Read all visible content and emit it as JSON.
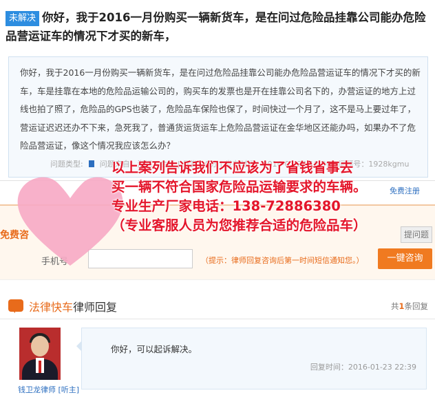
{
  "question": {
    "status_badge": "未解决",
    "title": "你好，我于2016一月份购买一辆新货车，是在问过危险品挂靠公司能办危险品营运证车的情况下才买的新车，",
    "body": "你好，我于2016一月份购买一辆新货车，是在问过危险品挂靠公司能办危险品营运证车的情况下才买的新车，车是挂靠在本地的危险品运输公司的，购买车的发票也是开在挂靠公司名下的，办营运证的地方上过线也拍了照了，危险品的GPS也装了，危险品车保险也保了，时间快过一个月了，这不是马上要过年了，营运证迟迟还办不下来，急死我了，普通货运货运车上危险品营运证在金华地区还能办吗，如果办不了危险品营运证，像这个情况我应该怎么办？",
    "meta_label": "问题类型:",
    "meta_rest": "问题来自：浙江 · 金华 | 悬赏：0分 | 发布时间：2016-01-23 19:36 | 问题号：1928kgmu"
  },
  "register_link": "免费注册",
  "free_consult": {
    "label": "免费咨",
    "ask_button": "提问题",
    "phone_label": "手机号",
    "phone_value": "",
    "tip": "（提示：律师回复咨询后第一时间短信通知您。）",
    "submit_button": "一键咨询"
  },
  "answers": {
    "title_highlight": "法律快车",
    "title_rest": "律师回复",
    "count_prefix": "共",
    "count_num": "1",
    "count_suffix": "条回复",
    "items": [
      {
        "lawyer_name": "钱卫龙律师 [听主]",
        "text": "你好，可以起诉解决。",
        "time": "回复时间：2016-01-23 22:39"
      }
    ]
  },
  "ad_overlay": {
    "line1": "以上案列告诉我们不应该为了省钱省事去",
    "line2": "买一辆不符合国家危险品运输要求的车辆。",
    "line3": "专业生产厂家电话：138-72886380",
    "line4": "（专业客服人员为您推荐合适的危险品车）",
    "color": "#e4162b",
    "heart_color": "#f7a8c4"
  }
}
